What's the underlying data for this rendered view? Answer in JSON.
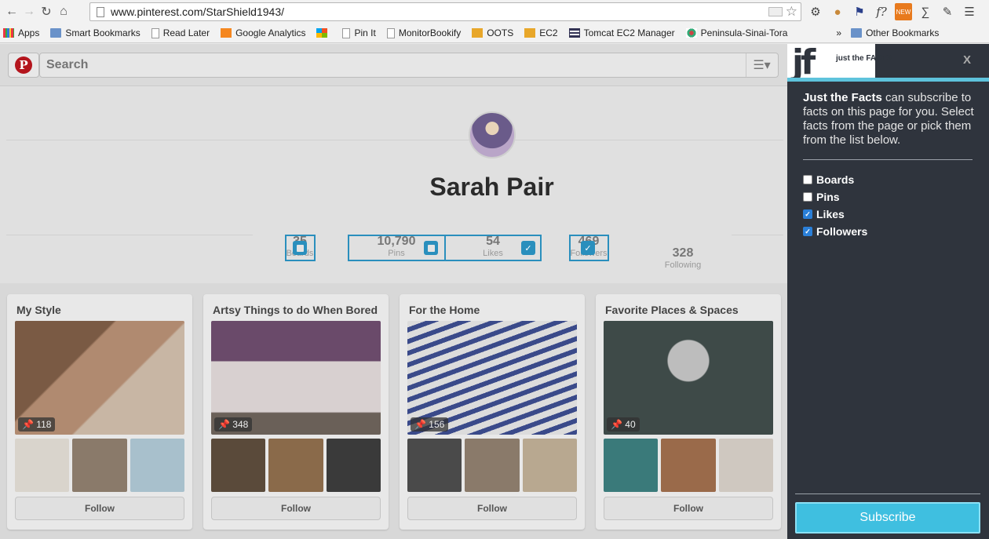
{
  "browser": {
    "url": "www.pinterest.com/StarShield1943/",
    "bookmarks": [
      "Apps",
      "Smart Bookmarks",
      "Read Later",
      "Google Analytics",
      "Pin It",
      "MonitorBookify",
      "OOTS",
      "EC2",
      "Tomcat EC2 Manager",
      "Peninsula-Sinai-Tora"
    ],
    "more": "»",
    "other_bookmarks": "Other Bookmarks",
    "ext_new": "NEW"
  },
  "pinterest": {
    "search_placeholder": "Search",
    "profile_name": "Sarah Pair",
    "stats": [
      {
        "num": "35",
        "label": "Boards",
        "checked": false
      },
      {
        "num": "10,790",
        "label": "Pins",
        "checked": false
      },
      {
        "num": "54",
        "label": "Likes",
        "checked": true
      },
      {
        "num": "469",
        "label": "Followers",
        "checked": true
      },
      {
        "num": "328",
        "label": "Following"
      }
    ],
    "boards": [
      {
        "title": "My Style",
        "pins": "118",
        "follow": "Follow"
      },
      {
        "title": "Artsy Things to do When Bored",
        "pins": "348",
        "follow": "Follow"
      },
      {
        "title": "For the Home",
        "pins": "156",
        "follow": "Follow"
      },
      {
        "title": "Favorite Places & Spaces",
        "pins": "40",
        "follow": "Follow"
      }
    ]
  },
  "jtf": {
    "close": "X",
    "logo_text": "just the FACTS",
    "brand": "Just the Facts",
    "description": "can subscribe to facts on this page for you. Select facts from the page or pick them from the list below.",
    "items": [
      {
        "label": "Boards",
        "checked": false
      },
      {
        "label": "Pins",
        "checked": false
      },
      {
        "label": "Likes",
        "checked": true
      },
      {
        "label": "Followers",
        "checked": true
      }
    ],
    "subscribe": "Subscribe"
  }
}
